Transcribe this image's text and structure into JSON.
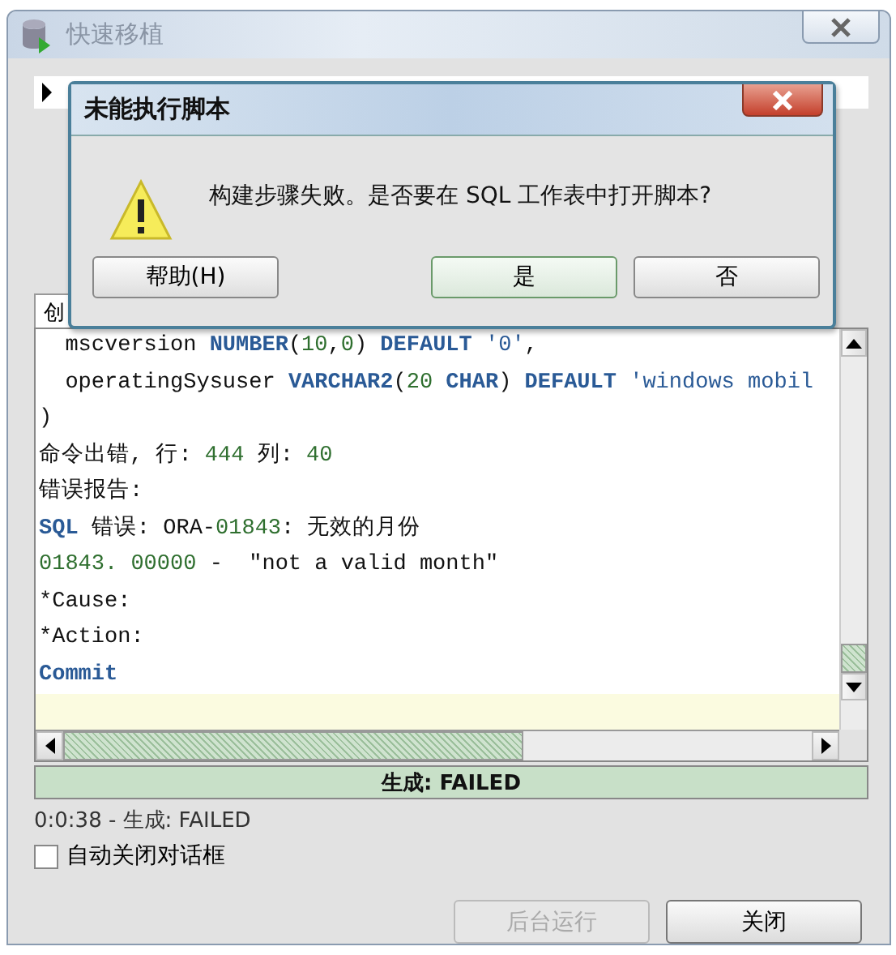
{
  "window": {
    "title": "快速移植"
  },
  "tree": [
    {
      "expanded": false
    }
  ],
  "tabs": [
    {
      "label": "创",
      "selected": true
    }
  ],
  "editor": {
    "lines": [
      [
        {
          "kind": "plain",
          "text": "  mscversion "
        },
        {
          "kind": "keyword",
          "text": "NUMBER"
        },
        {
          "kind": "plain",
          "text": "("
        },
        {
          "kind": "number",
          "text": "10"
        },
        {
          "kind": "plain",
          "text": ","
        },
        {
          "kind": "number",
          "text": "0"
        },
        {
          "kind": "plain",
          "text": ") "
        },
        {
          "kind": "keyword",
          "text": "DEFAULT"
        },
        {
          "kind": "string",
          "text": " '0'"
        },
        {
          "kind": "plain",
          "text": ","
        }
      ],
      [
        {
          "kind": "plain",
          "text": "  operatingSysuser "
        },
        {
          "kind": "keyword",
          "text": "VARCHAR2"
        },
        {
          "kind": "plain",
          "text": "("
        },
        {
          "kind": "number",
          "text": "20"
        },
        {
          "kind": "keyword",
          "text": " CHAR"
        },
        {
          "kind": "plain",
          "text": ") "
        },
        {
          "kind": "keyword",
          "text": "DEFAULT"
        },
        {
          "kind": "string",
          "text": " 'windows mobil"
        }
      ],
      [
        {
          "kind": "plain",
          "text": ")"
        }
      ],
      [
        {
          "kind": "plain",
          "text": "命令出错, 行: "
        },
        {
          "kind": "number",
          "text": "444"
        },
        {
          "kind": "plain",
          "text": " 列: "
        },
        {
          "kind": "number",
          "text": "40"
        }
      ],
      [
        {
          "kind": "plain",
          "text": "错误报告:"
        }
      ],
      [
        {
          "kind": "keyword",
          "text": "SQL"
        },
        {
          "kind": "plain",
          "text": " 错误: ORA-"
        },
        {
          "kind": "number",
          "text": "01843"
        },
        {
          "kind": "plain",
          "text": ": 无效的月份"
        }
      ],
      [
        {
          "kind": "number",
          "text": "01843. 00000"
        },
        {
          "kind": "plain",
          "text": " -  \"not a valid month\""
        }
      ],
      [
        {
          "kind": "plain",
          "text": "*Cause:"
        }
      ],
      [
        {
          "kind": "plain",
          "text": "*Action:"
        }
      ],
      [
        {
          "kind": "keyword",
          "text": "Commit"
        }
      ]
    ]
  },
  "progress": {
    "level": 1,
    "label": "生成: FAILED"
  },
  "status": "0:0:38 - 生成: FAILED",
  "auto_close": {
    "label": "自动关闭对话框",
    "checked": false
  },
  "buttons": [
    {
      "label": "后台运行",
      "disabled": true
    },
    {
      "label": "关闭",
      "disabled": false
    }
  ],
  "dialog": {
    "title": "未能执行脚本",
    "message": "构建步骤失败。是否要在 SQL 工作表中打开脚本?",
    "buttons": [
      {
        "label": "帮助(H)",
        "selected": false
      },
      {
        "label": "是",
        "selected": true
      },
      {
        "label": "否",
        "selected": false
      }
    ]
  }
}
